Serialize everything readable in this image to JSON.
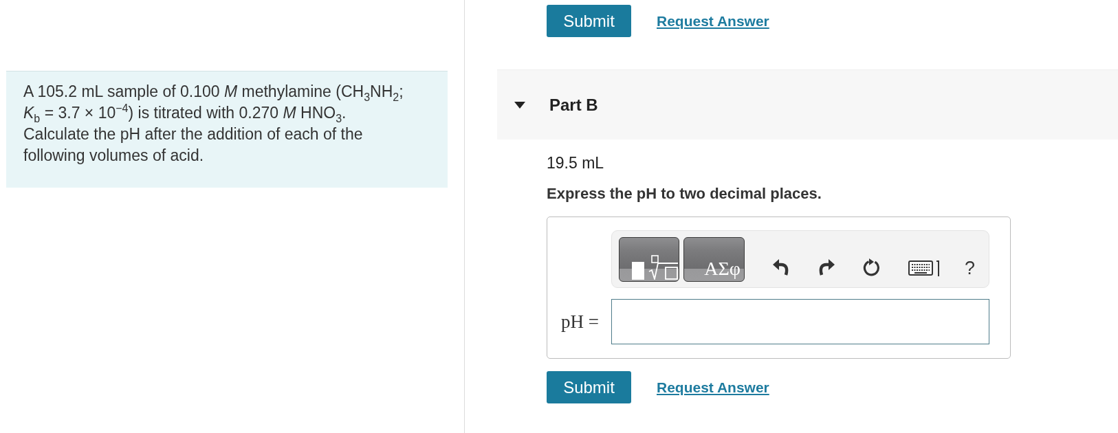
{
  "problem": {
    "text": "A 105.2 mL sample of 0.100 *M* methylamine (CH$_{3}$NH$_{2}$; *K*$_{b}$ = 3.7 × 10$^{−4}$) is titrated with 0.270 *M* HNO$_{3}$. Calculate the pH after the addition of each of the following volumes of acid."
  },
  "previous_actions": [
    {
      "kind": "submit",
      "label": "Submit"
    },
    {
      "kind": "link",
      "label": "Request Answer"
    }
  ],
  "part": {
    "title": "Part B",
    "expanded": true,
    "given": "19.5 mL",
    "instruction": "Express the pH to two decimal places.",
    "toolbar": [
      {
        "kind": "templates"
      },
      {
        "kind": "symbols",
        "label": "ΑΣφ"
      },
      {
        "kind": "undo"
      },
      {
        "kind": "redo"
      },
      {
        "kind": "reset"
      },
      {
        "kind": "keyboard"
      },
      {
        "kind": "help",
        "label": "?"
      }
    ],
    "answer": {
      "label": "pH ="
    },
    "actions": [
      {
        "kind": "submit",
        "label": "Submit"
      },
      {
        "kind": "link",
        "label": "Request Answer"
      }
    ]
  }
}
